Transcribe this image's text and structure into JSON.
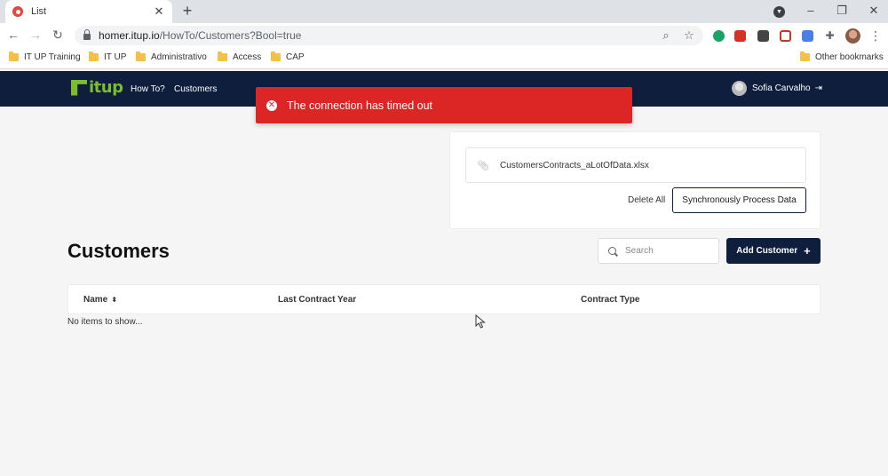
{
  "browser": {
    "tab_title": "List",
    "url_host": "homer.itup.io",
    "url_path": "/HowTo/Customers?Bool=true",
    "bookmarks": [
      "IT UP Training",
      "IT UP",
      "Administrativo",
      "Access",
      "CAP"
    ],
    "other_bookmarks": "Other bookmarks"
  },
  "app": {
    "logo_text": "itup",
    "nav": [
      "How To?",
      "Customers"
    ],
    "user_name": "Sofia Carvalho"
  },
  "toast": {
    "message": "The connection has timed out",
    "color": "#dc2626"
  },
  "upload": {
    "file_name": "CustomersContracts_aLotOfData.xlsx",
    "delete_all_label": "Delete All",
    "sync_label": "Synchronously Process Data"
  },
  "customers": {
    "title": "Customers",
    "search_placeholder": "Search",
    "add_label": "Add Customer",
    "columns": [
      "Name",
      "Last Contract Year",
      "Contract Type"
    ],
    "empty_message": "No items to show..."
  },
  "colors": {
    "navy": "#0e1e3c",
    "brand_green": "#7cbd2d"
  }
}
